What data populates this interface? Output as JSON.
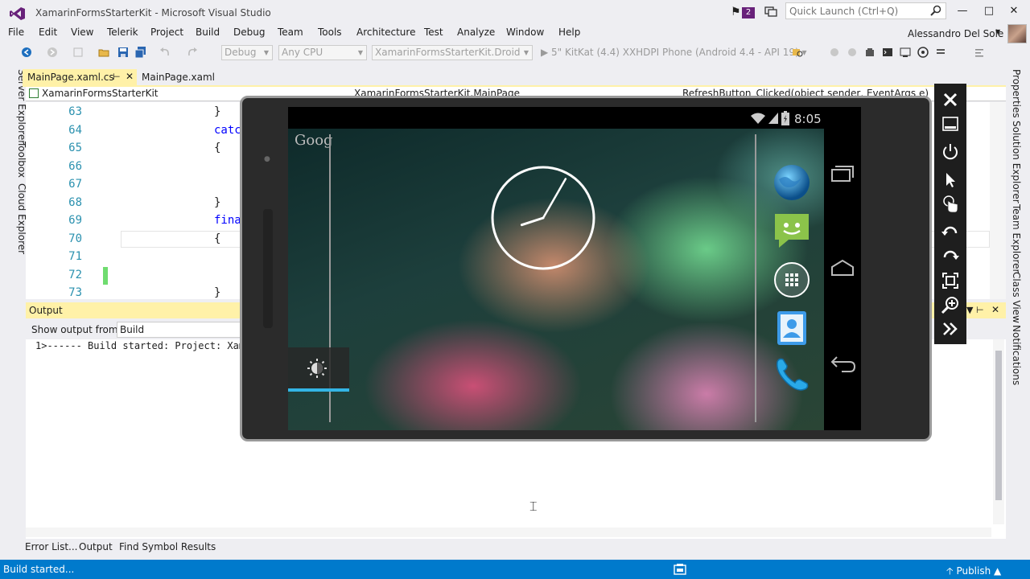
{
  "window": {
    "title": "XamarinFormsStarterKit - Microsoft Visual Studio",
    "notification_count": "2",
    "quick_launch_placeholder": "Quick Launch (Ctrl+Q)",
    "user_name": "Alessandro Del Sole"
  },
  "menu": [
    "File",
    "Edit",
    "View",
    "Telerik",
    "Project",
    "Build",
    "Debug",
    "Team",
    "Tools",
    "Architecture",
    "Test",
    "Analyze",
    "Window",
    "Help"
  ],
  "toolbar": {
    "config": "Debug",
    "platform": "Any CPU",
    "startup_project": "XamarinFormsStarterKit.Droid",
    "run_target": "5\" KitKat (4.4) XXHDPI Phone (Android 4.4 - API 19)"
  },
  "left_tabs": [
    "Server Explorer",
    "Toolbox",
    "Cloud Explorer"
  ],
  "right_tabs": [
    "Properties",
    "Solution Explorer",
    "Team Explorer",
    "Class View",
    "Notifications"
  ],
  "doc_tabs": {
    "active": "MainPage.xaml.cs",
    "second": "MainPage.xaml"
  },
  "navbar": {
    "project": "XamarinFormsStarterKit",
    "class": "XamarinFormsStarterKit.MainPage",
    "member": "RefreshButton_Clicked(object sender, EventArgs e)"
  },
  "code_lines": [
    {
      "num": "63",
      "text": "}"
    },
    {
      "num": "64",
      "text": "catc"
    },
    {
      "num": "65",
      "text": "{"
    },
    {
      "num": "66",
      "text": ""
    },
    {
      "num": "67",
      "text": ""
    },
    {
      "num": "68",
      "text": "}"
    },
    {
      "num": "69",
      "text": "fina"
    },
    {
      "num": "70",
      "text": "{"
    },
    {
      "num": "71",
      "text": ""
    },
    {
      "num": "72",
      "text": ""
    },
    {
      "num": "73",
      "text": "}"
    }
  ],
  "output": {
    "title": "Output",
    "show_from_label": "Show output from:",
    "source": "Build",
    "line1": "1>------ Build started: Project: Xama"
  },
  "bottom_tabs": [
    "Error List...",
    "Output",
    "Find Symbol Results"
  ],
  "status": {
    "text": "Build started...",
    "publish": "Publish"
  },
  "emulator": {
    "time": "8:05",
    "google_label": "Goog",
    "clock_hour_fraction": 0.7,
    "clock_minute_fraction": 0.083
  },
  "colors": {
    "accent_blue": "#007acc",
    "tab_yellow": "#fff1a8",
    "holo_blue": "#33b5e5"
  }
}
